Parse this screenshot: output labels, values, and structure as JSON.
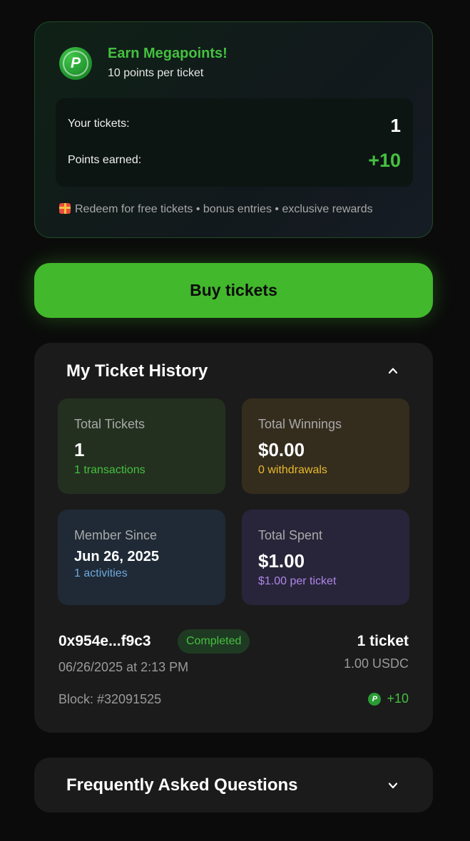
{
  "points": {
    "title": "Earn Megapoints!",
    "subtitle": "10 points per ticket",
    "logo_letter": "P",
    "tickets_label": "Your tickets:",
    "tickets_value": "1",
    "earned_label": "Points earned:",
    "earned_value": "+10",
    "perks": "Redeem for free tickets • bonus entries • exclusive rewards"
  },
  "buy_button": {
    "label": "Buy tickets"
  },
  "history": {
    "title": "My Ticket History",
    "tiles": [
      {
        "label": "Total Tickets",
        "value": "1",
        "sub": "1 transactions"
      },
      {
        "label": "Total Winnings",
        "value": "$0.00",
        "sub": "0 withdrawals"
      },
      {
        "label": "Member Since",
        "value": "Jun 26, 2025",
        "sub": "1 activities"
      },
      {
        "label": "Total Spent",
        "value": "$1.00",
        "sub": "$1.00 per ticket"
      }
    ],
    "transaction": {
      "hash": "0x954e...f9c3",
      "status": "Completed",
      "date": "06/26/2025 at 2:13 PM",
      "block": "Block: #32091525",
      "count": "1 ticket",
      "amount": "1.00 USDC",
      "points": "+10",
      "points_icon_letter": "P"
    }
  },
  "faq": {
    "title": "Frequently Asked Questions"
  },
  "colors": {
    "accent_green": "#42b82c",
    "text_green": "#45c040",
    "winnings_yellow": "#e8b92c",
    "member_blue": "#6fa8dc",
    "spent_purple": "#b085e8"
  },
  "icons": [
    "p-logo-icon",
    "gift-icon",
    "chevron-up-icon",
    "chevron-down-icon"
  ]
}
